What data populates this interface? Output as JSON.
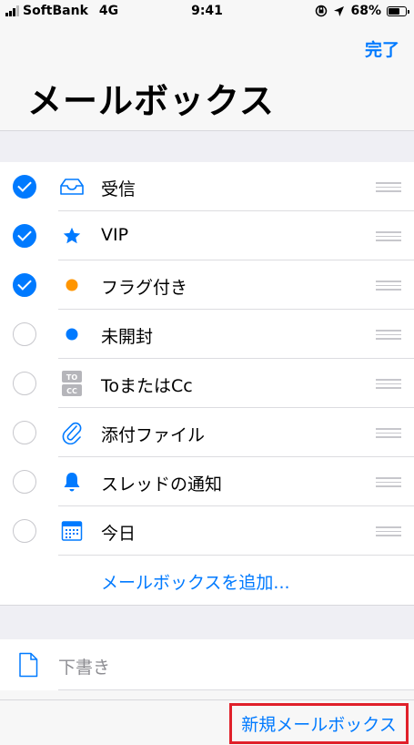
{
  "status_bar": {
    "carrier": "SoftBank",
    "network": "4G",
    "time": "9:41",
    "battery_percent": "68%",
    "battery_level": 0.68
  },
  "header": {
    "done_label": "完了",
    "title": "メールボックス"
  },
  "mailboxes": [
    {
      "label": "受信",
      "checked": true,
      "icon": "inbox-tray-icon"
    },
    {
      "label": "VIP",
      "checked": true,
      "icon": "star-icon"
    },
    {
      "label": "フラグ付き",
      "checked": true,
      "icon": "orange-dot-icon"
    },
    {
      "label": "未開封",
      "checked": false,
      "icon": "blue-dot-icon"
    },
    {
      "label": "ToまたはCc",
      "checked": false,
      "icon": "to-cc-icon"
    },
    {
      "label": "添付ファイル",
      "checked": false,
      "icon": "paperclip-icon"
    },
    {
      "label": "スレッドの通知",
      "checked": false,
      "icon": "bell-icon"
    },
    {
      "label": "今日",
      "checked": false,
      "icon": "calendar-icon"
    }
  ],
  "add_mailbox_label": "メールボックスを追加...",
  "drafts_label": "下書き",
  "to_cc_icon_text": {
    "to": "TO",
    "cc": "CC"
  },
  "bottom_bar": {
    "new_mailbox_label": "新規メールボックス"
  },
  "colors": {
    "accent": "#007aff",
    "flag": "#ff9500",
    "highlight": "#e0202a"
  }
}
